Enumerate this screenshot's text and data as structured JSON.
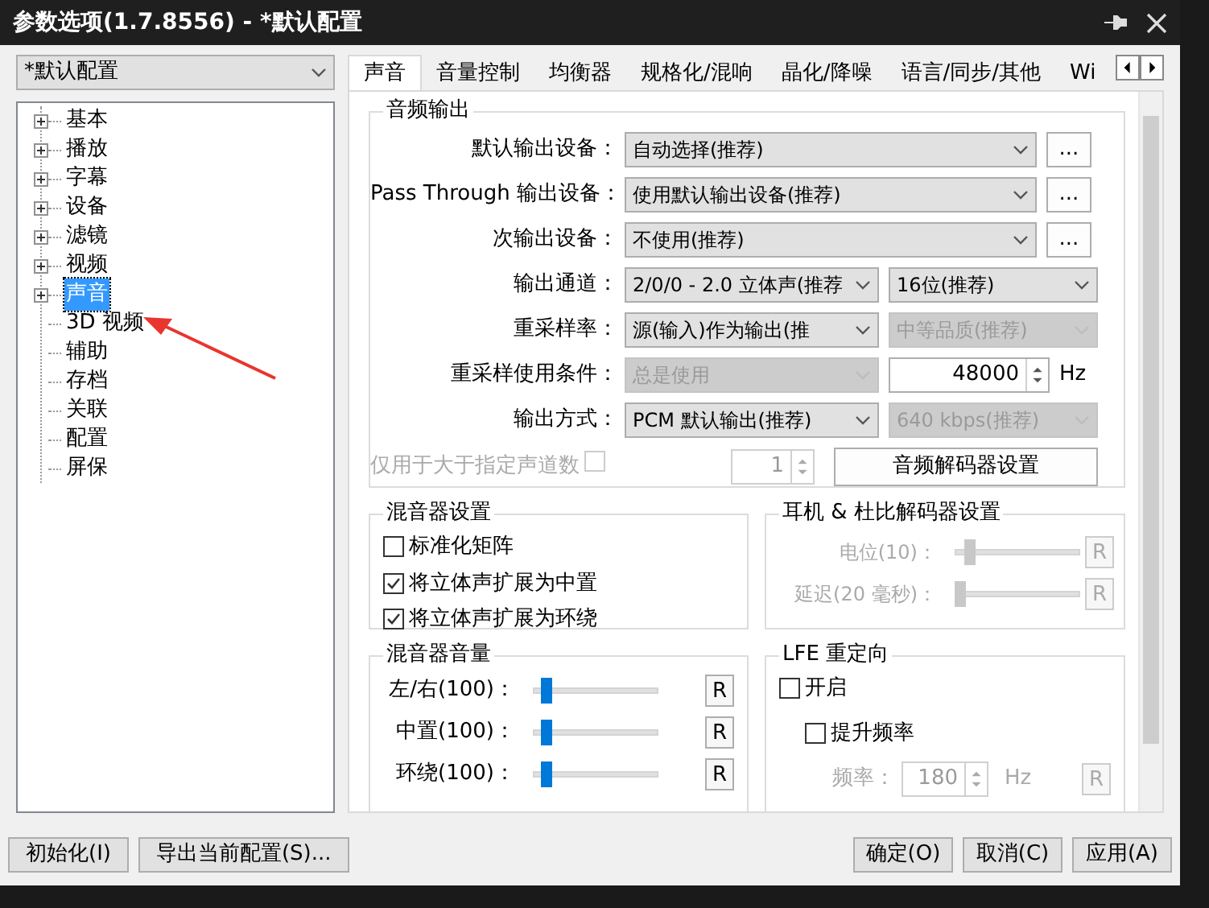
{
  "window": {
    "title": "参数选项(1.7.8556) - *默认配置"
  },
  "profile_select": {
    "value": "*默认配置"
  },
  "tree": [
    {
      "label": "基本",
      "expandable": true,
      "selected": false
    },
    {
      "label": "播放",
      "expandable": true,
      "selected": false
    },
    {
      "label": "字幕",
      "expandable": true,
      "selected": false
    },
    {
      "label": "设备",
      "expandable": true,
      "selected": false
    },
    {
      "label": "滤镜",
      "expandable": true,
      "selected": false
    },
    {
      "label": "视频",
      "expandable": true,
      "selected": false
    },
    {
      "label": "声音",
      "expandable": true,
      "selected": true
    },
    {
      "label": "3D 视频",
      "expandable": false,
      "selected": false
    },
    {
      "label": "辅助",
      "expandable": false,
      "selected": false
    },
    {
      "label": "存档",
      "expandable": false,
      "selected": false
    },
    {
      "label": "关联",
      "expandable": false,
      "selected": false
    },
    {
      "label": "配置",
      "expandable": false,
      "selected": false
    },
    {
      "label": "屏保",
      "expandable": false,
      "selected": false
    }
  ],
  "tabs": [
    {
      "label": "声音",
      "selected": true
    },
    {
      "label": "音量控制",
      "selected": false
    },
    {
      "label": "均衡器",
      "selected": false
    },
    {
      "label": "规格化/混响",
      "selected": false
    },
    {
      "label": "晶化/降噪",
      "selected": false
    },
    {
      "label": "语言/同步/其他",
      "selected": false
    },
    {
      "label": "Wi",
      "selected": false
    }
  ],
  "audio_output": {
    "title": "音频输出",
    "rows": [
      {
        "kind": "wide",
        "label": "默认输出设备：",
        "select": {
          "value": "自动选择(推荐)",
          "disabled": false
        },
        "button": "..."
      },
      {
        "kind": "wide",
        "label": "Pass Through 输出设备：",
        "select": {
          "value": "使用默认输出设备(推荐)",
          "disabled": false
        },
        "button": "..."
      },
      {
        "kind": "wide",
        "label": "次输出设备：",
        "select": {
          "value": "不使用(推荐)",
          "disabled": false
        },
        "button": "..."
      },
      {
        "kind": "pair",
        "label": "输出通道：",
        "select": {
          "value": "2/0/0 - 2.0 立体声(推荐",
          "disabled": false
        },
        "select2": {
          "value": "16位(推荐)",
          "disabled": false
        }
      },
      {
        "kind": "pair",
        "label": "重采样率：",
        "select": {
          "value": "源(输入)作为输出(推",
          "disabled": false
        },
        "select2": {
          "value": "中等品质(推荐)",
          "disabled": true
        }
      },
      {
        "kind": "spin",
        "label": "重采样使用条件：",
        "select": {
          "value": "总是使用",
          "disabled": true
        },
        "spin": "48000",
        "unit": "Hz"
      },
      {
        "kind": "pair",
        "label": "输出方式：",
        "select": {
          "value": "PCM 默认输出(推荐)",
          "disabled": false
        },
        "select2": {
          "value": "640 kbps(推荐)",
          "disabled": true
        }
      }
    ],
    "channel_limit": {
      "label": "仅用于大于指定声道数",
      "checked": false,
      "disabled": true,
      "value": "1"
    },
    "decoder_button": "音频解码器设置"
  },
  "mixer_settings": {
    "title": "混音器设置",
    "options": [
      {
        "label": "标准化矩阵",
        "checked": false
      },
      {
        "label": "将立体声扩展为中置",
        "checked": true
      },
      {
        "label": "将立体声扩展为环绕",
        "checked": true
      }
    ]
  },
  "headphone": {
    "title": "耳机 & 杜比解码器设置",
    "disabled": true,
    "sliders": [
      {
        "label": "电位(10)：",
        "level": 0.12,
        "reset": "R"
      },
      {
        "label": "延迟(20 毫秒)：",
        "level": 0.04,
        "reset": "R"
      }
    ]
  },
  "mixer_volume": {
    "title": "混音器音量",
    "sliders": [
      {
        "label": "左/右(100)：",
        "level": 0.1,
        "reset": "R"
      },
      {
        "label": "中置(100)：",
        "level": 0.1,
        "reset": "R"
      },
      {
        "label": "环绕(100)：",
        "level": 0.1,
        "reset": "R"
      }
    ]
  },
  "lfe": {
    "title": "LFE 重定向",
    "options": [
      {
        "label": "开启",
        "checked": false,
        "children": [
          {
            "label": "提升频率",
            "checked": false
          }
        ]
      }
    ],
    "frequency": {
      "label": "频率：",
      "value": "180",
      "unit": "Hz",
      "reset": "R",
      "disabled": true
    }
  },
  "footer": {
    "left": [
      "初始化(I)",
      "导出当前配置(S)..."
    ],
    "right": [
      "确定(O)",
      "取消(C)",
      "应用(A)"
    ]
  }
}
